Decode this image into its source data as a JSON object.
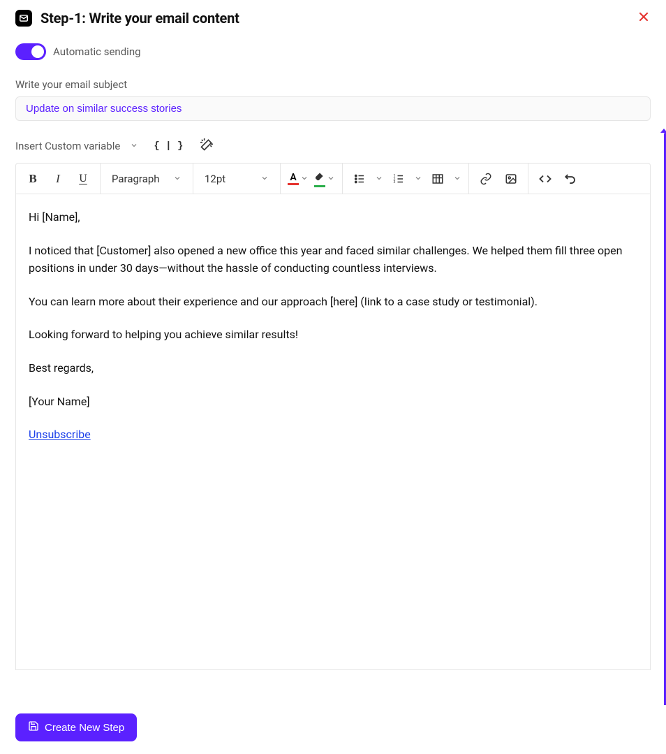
{
  "header": {
    "title": "Step-1:  Write your email content"
  },
  "toggle": {
    "label": "Automatic sending",
    "on": true
  },
  "subject": {
    "label": "Write your email subject",
    "value": "Update on similar success stories"
  },
  "customVar": {
    "label": "Insert Custom variable",
    "braces": "{ | }"
  },
  "toolbar": {
    "paragraph": "Paragraph",
    "fontsize": "12pt"
  },
  "body": {
    "greeting": "Hi [Name],",
    "p1": "I noticed that [Customer] also opened a new office this year and faced similar challenges. We helped them fill three open positions in under 30 days—without the hassle of conducting countless interviews.",
    "p2": "You can learn more about their experience and our approach [here] (link to a case study or testimonial).",
    "p3": "Looking forward to helping you achieve similar results!",
    "signoff": "Best regards,",
    "signature": "[Your Name]",
    "unsubscribe": "Unsubscribe"
  },
  "footer": {
    "createBtn": "Create New Step"
  }
}
